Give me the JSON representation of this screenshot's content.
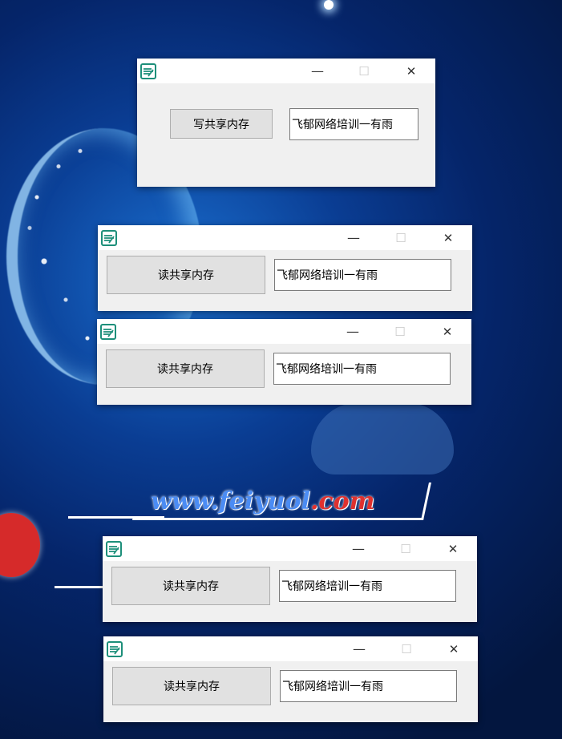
{
  "wallpaper": {
    "url_main": "www.feiyuol",
    "url_tld": ".com"
  },
  "windows": [
    {
      "button_label": "写共享内存",
      "text_value": "飞郁网络培训一有雨"
    },
    {
      "button_label": "读共享内存",
      "text_value": "飞郁网络培训一有雨"
    },
    {
      "button_label": "读共享内存",
      "text_value": "飞郁网络培训一有雨"
    },
    {
      "button_label": "读共享内存",
      "text_value": "飞郁网络培训一有雨"
    },
    {
      "button_label": "读共享内存",
      "text_value": "飞郁网络培训一有雨"
    }
  ],
  "controls": {
    "minimize": "—",
    "maximize": "☐",
    "close": "✕"
  },
  "icons": {
    "app": "app-icon",
    "minimize": "minimize-icon",
    "maximize": "maximize-icon",
    "close": "close-icon"
  }
}
